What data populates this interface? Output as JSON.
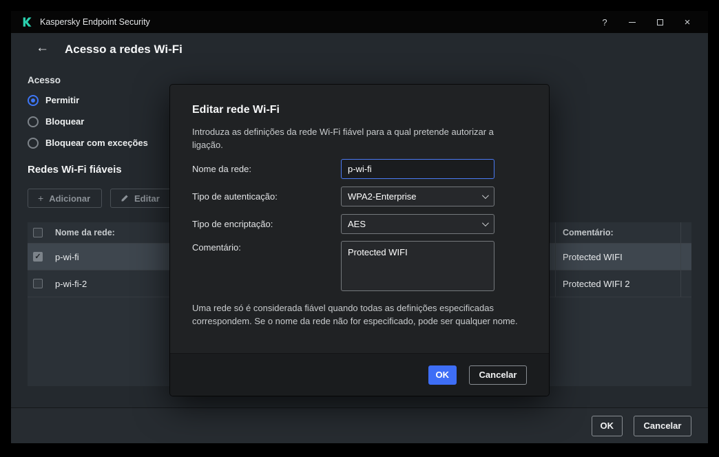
{
  "window": {
    "titlebar": {
      "app_title": "Kaspersky Endpoint Security"
    },
    "footer": {
      "ok_label": "OK",
      "cancel_label": "Cancelar"
    }
  },
  "icons": {
    "back": "←",
    "help": "?",
    "close": "×",
    "add": "+",
    "check": "✓"
  },
  "page": {
    "title": "Acesso a redes Wi-Fi",
    "access": {
      "heading": "Acesso",
      "options": [
        {
          "label": "Permitir",
          "selected": true
        },
        {
          "label": "Bloquear",
          "selected": false
        },
        {
          "label": "Bloquear com exceções",
          "selected": false
        }
      ]
    },
    "trusted": {
      "heading": "Redes Wi-Fi fiáveis",
      "add_label": "Adicionar",
      "edit_label": "Editar",
      "table": {
        "col_name": "Nome da rede:",
        "col_comment": "Comentário:",
        "rows": [
          {
            "name": "p-wi-fi",
            "comment": "Protected WIFI",
            "checked": true,
            "selected": true
          },
          {
            "name": "p-wi-fi-2",
            "comment": "Protected WIFI 2",
            "checked": false,
            "selected": false
          }
        ]
      }
    }
  },
  "dialog": {
    "title": "Editar rede Wi-Fi",
    "description": "Introduza as definições da rede Wi-Fi fiável para a qual pretende autorizar a ligação.",
    "fields": {
      "name": {
        "label": "Nome da rede:",
        "value": "p-wi-fi"
      },
      "auth": {
        "label": "Tipo de autenticação:",
        "value": "WPA2-Enterprise"
      },
      "encryption": {
        "label": "Tipo de encriptação:",
        "value": "AES"
      },
      "comment": {
        "label": "Comentário:",
        "value": "Protected WIFI"
      }
    },
    "note": "Uma rede só é considerada fiável quando todas as definições especificadas correspondem. Se o nome da rede não for especificado, pode ser qualquer nome.",
    "ok_label": "OK",
    "cancel_label": "Cancelar"
  },
  "colors": {
    "accent_blue": "#3e6ef6",
    "brand_green": "#2ad0ae",
    "page_bg": "#24292e",
    "dialog_bg": "#202224"
  }
}
